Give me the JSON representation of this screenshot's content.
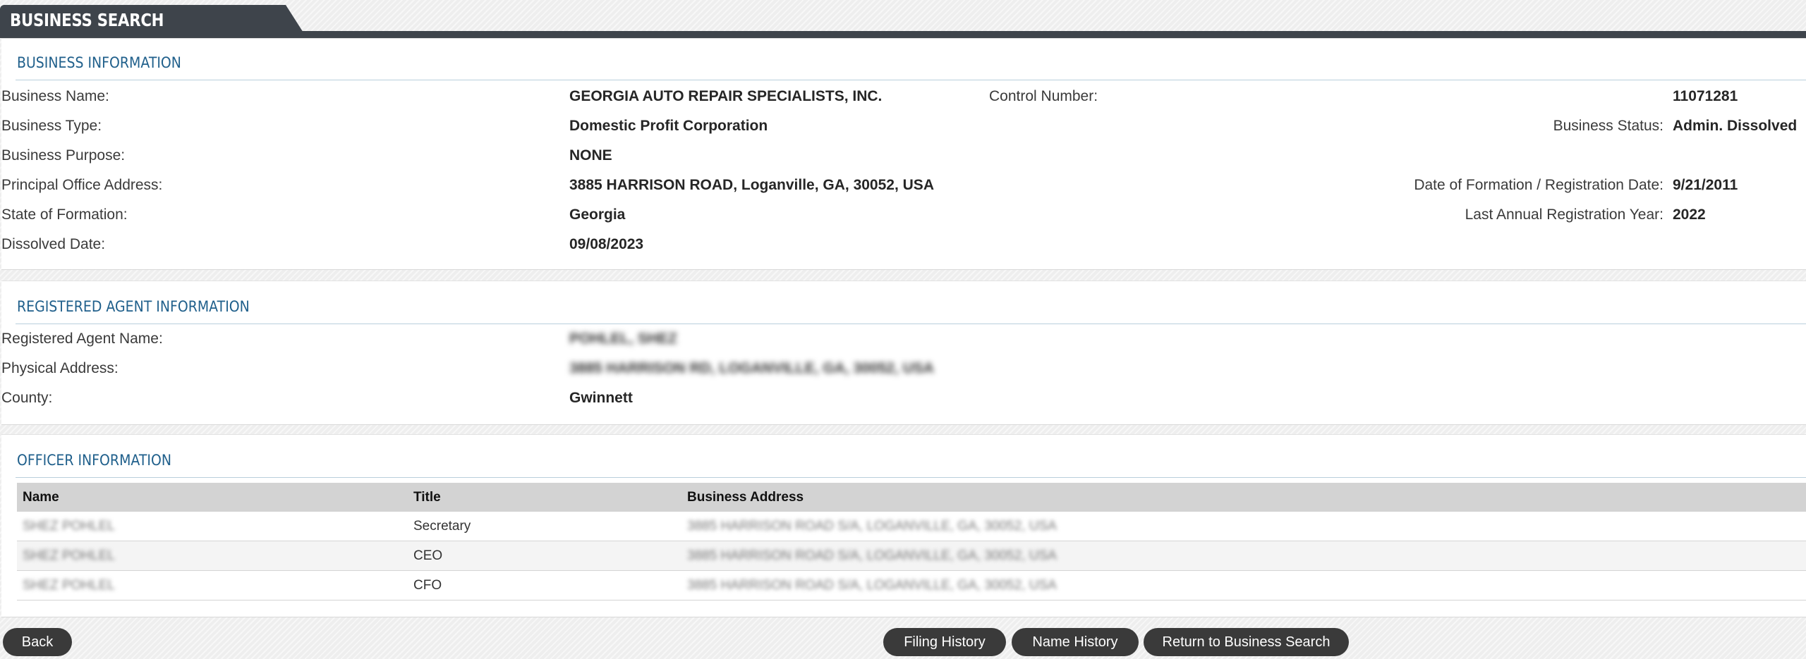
{
  "header": {
    "title": "BUSINESS SEARCH"
  },
  "business_info": {
    "section_title": "BUSINESS INFORMATION",
    "left_fields": [
      {
        "label": "Business Name:",
        "value": "GEORGIA AUTO REPAIR SPECIALISTS, INC."
      },
      {
        "label": "Business Type:",
        "value": "Domestic Profit Corporation"
      },
      {
        "label": "Business Purpose:",
        "value": "NONE"
      },
      {
        "label": "Principal Office Address:",
        "value": "3885 HARRISON ROAD, Loganville, GA, 30052, USA"
      },
      {
        "label": "State of Formation:",
        "value": "Georgia"
      },
      {
        "label": "Dissolved Date:",
        "value": "09/08/2023"
      }
    ],
    "right_fields": [
      {
        "label": "Control Number:",
        "value": "11071281"
      },
      {
        "label": "Business Status:",
        "value": "Admin. Dissolved"
      },
      {
        "label": "Date of Formation / Registration Date:",
        "value": "9/21/2011"
      },
      {
        "label": "Last Annual Registration Year:",
        "value": "2022"
      }
    ]
  },
  "agent_info": {
    "section_title": "REGISTERED AGENT INFORMATION",
    "fields": [
      {
        "label": "Registered Agent Name:",
        "value": "POHLEL, SHEZ"
      },
      {
        "label": "Physical Address:",
        "value": "3885 HARRISON RD, LOGANVILLE, GA, 30052, USA"
      },
      {
        "label": "County:",
        "value": "Gwinnett"
      }
    ]
  },
  "officer_info": {
    "section_title": "OFFICER INFORMATION",
    "columns": [
      "Name",
      "Title",
      "Business Address"
    ],
    "rows": [
      {
        "name": "SHEZ POHLEL",
        "title": "Secretary",
        "address": "3885 HARRISON ROAD S/A, LOGANVILLE, GA, 30052, USA"
      },
      {
        "name": "SHEZ POHLEL",
        "title": "CEO",
        "address": "3885 HARRISON ROAD S/A, LOGANVILLE, GA, 30052, USA"
      },
      {
        "name": "SHEZ POHLEL",
        "title": "CFO",
        "address": "3885 HARRISON ROAD S/A, LOGANVILLE, GA, 30052, USA"
      }
    ]
  },
  "buttons": {
    "back": "Back",
    "filing_history": "Filing History",
    "name_history": "Name History",
    "return_search": "Return to Business Search"
  }
}
